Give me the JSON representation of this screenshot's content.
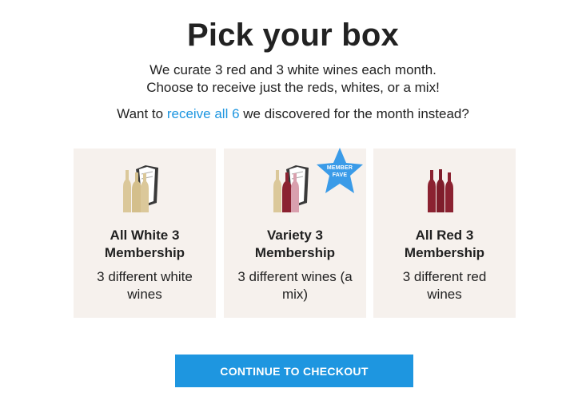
{
  "header": {
    "title": "Pick your box",
    "subtitle_line1": "We curate 3 red and 3 white wines each month.",
    "subtitle_line2": "Choose to receive just the reds, whites, or a mix!",
    "want_prefix": "Want to ",
    "want_link": "receive all 6",
    "want_suffix": " we discovered for the month instead?"
  },
  "cards": [
    {
      "name_line1": "All White 3",
      "name_line2": "Membership",
      "desc_line1": "3 different white",
      "desc_line2": "wines",
      "icon": "white-wine-bottles-icon"
    },
    {
      "name_line1": "Variety 3",
      "name_line2": "Membership",
      "desc_line1": "3 different wines (a",
      "desc_line2": "mix)",
      "icon": "mixed-wine-bottles-icon",
      "badge_line1": "MEMBER",
      "badge_line2": "FAVE"
    },
    {
      "name_line1": "All Red 3",
      "name_line2": "Membership",
      "desc_line1": "3 different red",
      "desc_line2": "wines",
      "icon": "red-wine-bottles-icon"
    }
  ],
  "checkout": {
    "label": "CONTINUE TO CHECKOUT"
  },
  "colors": {
    "accent": "#1e96e0",
    "card_bg": "#f6f1ed",
    "white_wine": "#dbc89a",
    "red_wine": "#8b2231",
    "rose_wine": "#d9a0ae",
    "badge": "#3a9be8"
  }
}
